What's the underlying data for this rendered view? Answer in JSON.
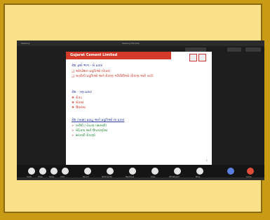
{
  "window": {
    "title": "Meeting Window",
    "left_label": "Meeting"
  },
  "slide": {
    "header": "Gujarat Cement Limited",
    "logos": [
      "logo-1",
      "logo-2"
    ],
    "section1": {
      "heading": "કેશ ફ્લો ભાગ - બે પ્રકાર",
      "items": [
        "ઓપરેશન પ્રવૃત્તિઓ (વેપાર)",
        "બાકીની પ્રવૃત્તિઓ અને રોકાણ ગતિવિધિઓ (રોકાણ અને ખર્ચ)"
      ]
    },
    "section2": {
      "heading": "કેશ - ત્રણ પ્રકાર",
      "items": [
        "રોકડ",
        "બેંકમાં",
        "ઉધારમાં"
      ]
    },
    "section3": {
      "heading": "કેશ (ખાસ) પ્રવાહ અને પ્રવૃત્તિઓ ના પ્રકાર",
      "items": [
        "ખરીદી / વેચાણ (સામગ્રી)",
        "મેડિકલ અને ઉપકરણોમાં",
        "સરકારી રોકાણો"
      ]
    },
    "page_number": "1"
  },
  "toolbar": {
    "buttons": [
      "Audio",
      "Video",
      "Share",
      "Chat",
      "Record",
      "Participants",
      "Reactions",
      "Apps",
      "Whiteboard",
      "More",
      "Leave"
    ]
  }
}
